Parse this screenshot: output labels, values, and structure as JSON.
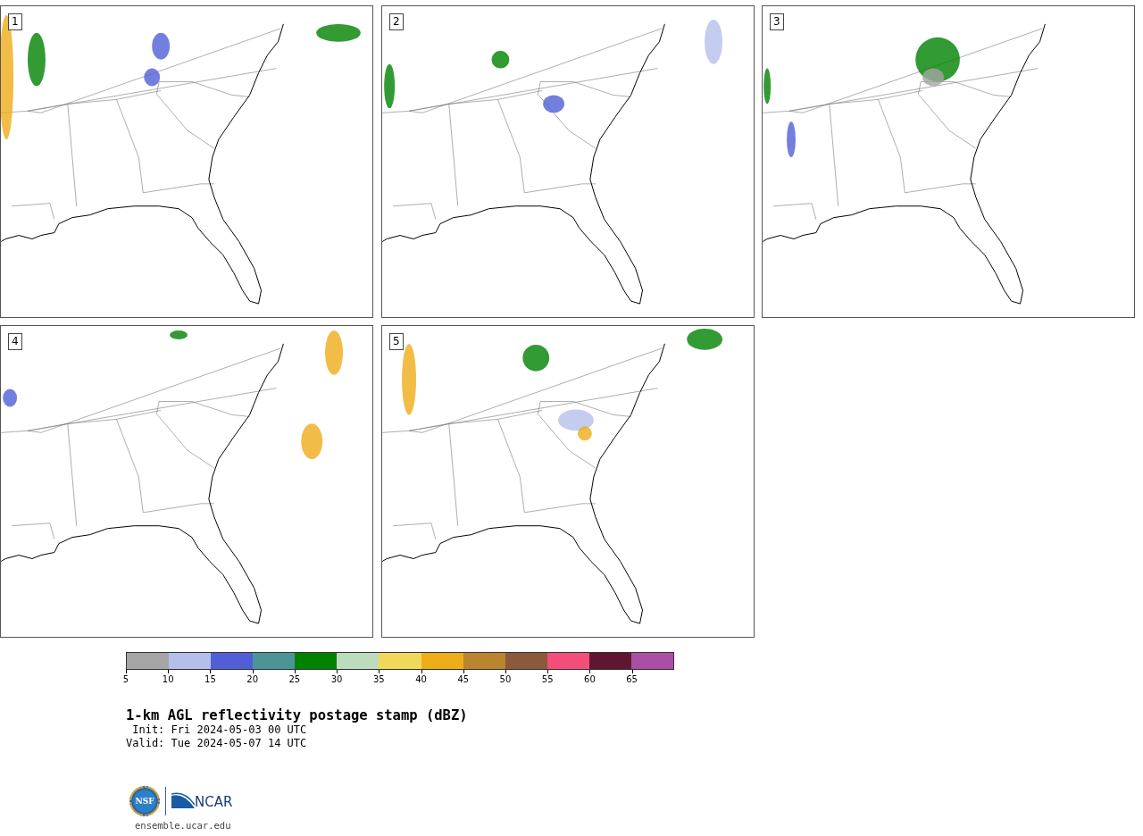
{
  "panels": [
    {
      "label": "1"
    },
    {
      "label": "2"
    },
    {
      "label": "3"
    },
    {
      "label": "4"
    },
    {
      "label": "5"
    }
  ],
  "colorbar": {
    "segments": [
      {
        "color": "#a5a5a5"
      },
      {
        "color": "#b5bfeb"
      },
      {
        "color": "#505fd6"
      },
      {
        "color": "#4d9499"
      },
      {
        "color": "#008200"
      },
      {
        "color": "#bddcbd"
      },
      {
        "color": "#f0d95a"
      },
      {
        "color": "#efac19"
      },
      {
        "color": "#bb842f"
      },
      {
        "color": "#8b5a3c"
      },
      {
        "color": "#f34e79"
      },
      {
        "color": "#601632"
      },
      {
        "color": "#ab4ea6"
      }
    ],
    "ticks": [
      "5",
      "10",
      "15",
      "20",
      "25",
      "30",
      "35",
      "40",
      "45",
      "50",
      "55",
      "60",
      "65"
    ]
  },
  "title": "1-km AGL reflectivity postage stamp (dBZ)",
  "init": " Init: Fri 2024-05-03 00 UTC",
  "valid": "Valid: Tue 2024-05-07 14 UTC",
  "logos": {
    "nsf": "NSF",
    "ncar": "NCAR"
  },
  "footer": "ensemble.ucar.edu"
}
